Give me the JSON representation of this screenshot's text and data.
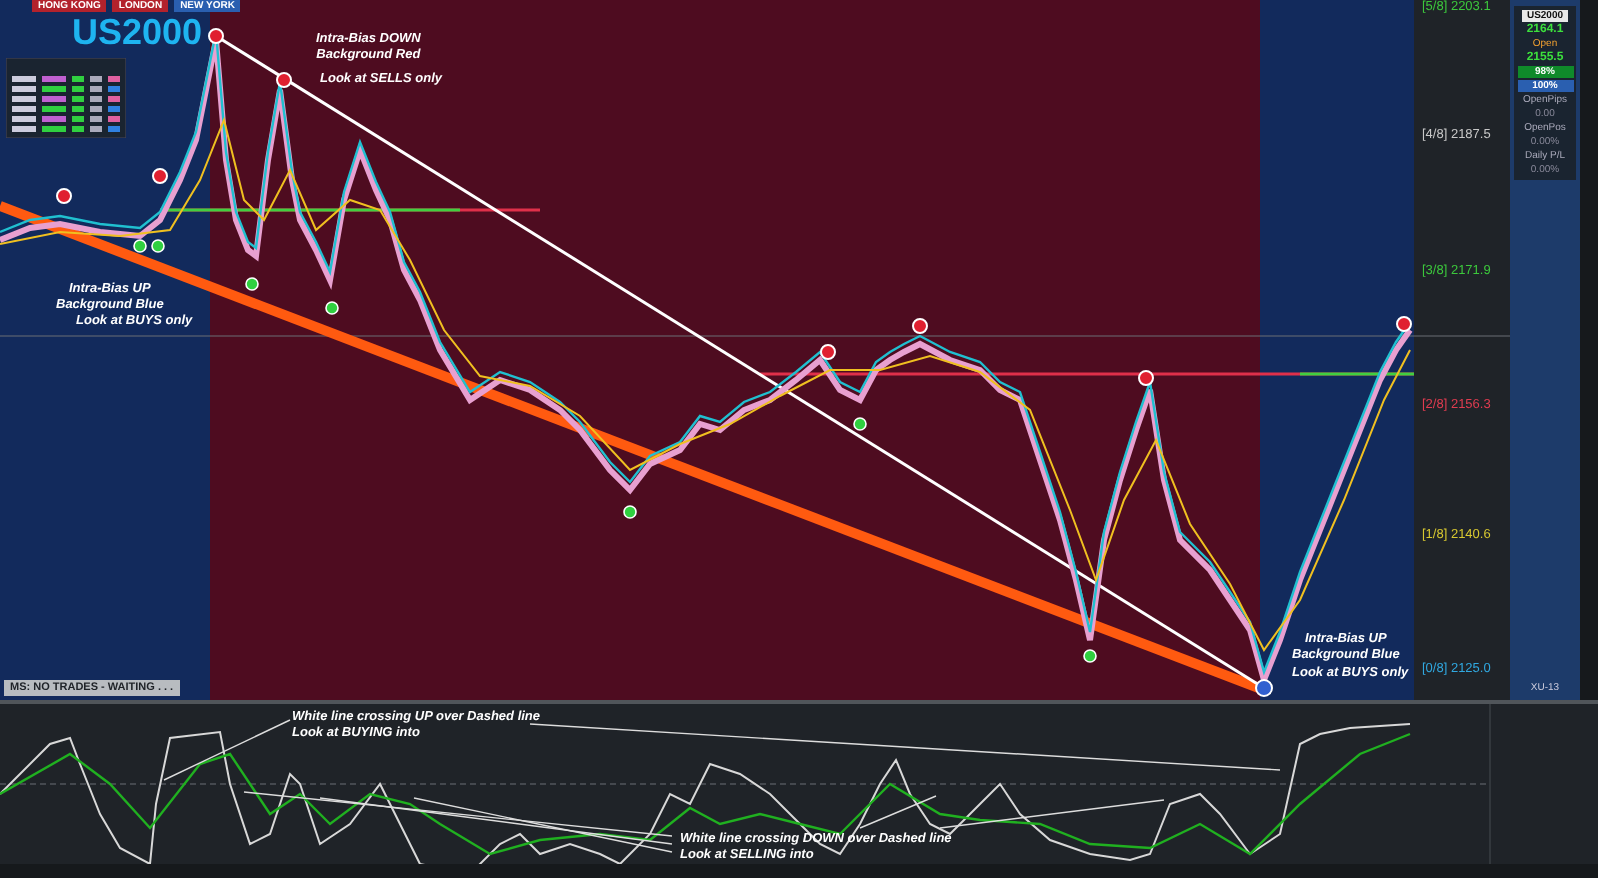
{
  "chart": {
    "symbol": "US2000",
    "sessions": [
      {
        "label": "HONG KONG",
        "color": "#b3222c"
      },
      {
        "label": "LONDON",
        "color": "#b3222c"
      },
      {
        "label": "NEW YORK",
        "color": "#2a5fb0"
      }
    ],
    "zones": [
      {
        "color": "#122a5c"
      },
      {
        "color": "#4e0c20"
      },
      {
        "color": "#122a5c"
      }
    ],
    "annotations": [
      {
        "text": "Intra-Bias DOWN\nBackground Red"
      },
      {
        "text": "Look at SELLS only"
      },
      {
        "text": "Intra-Bias UP\nBackground Blue"
      },
      {
        "text": "Look at BUYS only"
      },
      {
        "text": "Intra-Bias UP\nBackground Blue"
      },
      {
        "text": "Look at BUYS only"
      }
    ],
    "levels": [
      {
        "label": "[5/8] 2203.1",
        "color": "#3cc83c"
      },
      {
        "label": "[4/8] 2187.5",
        "color": "#c8c8c8"
      },
      {
        "label": "[3/8] 2171.9",
        "color": "#3cc83c"
      },
      {
        "label": "[2/8] 2156.3",
        "color": "#e03c50"
      },
      {
        "label": "[1/8] 2140.6",
        "color": "#d8c830"
      },
      {
        "label": "[0/8] 2125.0",
        "color": "#30a8e0"
      }
    ],
    "status": "MS: NO TRADES - WAITING . . ."
  },
  "info_panel": {
    "symbol": "US2000",
    "price": "2164.1",
    "open_label": "Open",
    "open_price": "2155.5",
    "meters": [
      {
        "reading": "98%",
        "kind": "green"
      },
      {
        "reading": "100%",
        "kind": "blue"
      }
    ],
    "stats": [
      {
        "label": "OpenPips",
        "value": "0.00"
      },
      {
        "label": "OpenPos",
        "value": "0.00%"
      },
      {
        "label": "Daily P/L",
        "value": "0.00%"
      }
    ],
    "footer": "XU-13"
  },
  "oscillator": {
    "annotations": [
      {
        "text": "White line crossing UP over Dashed line\nLook at BUYING into"
      },
      {
        "text": "White line crossing DOWN over Dashed line\nLook at SELLING into"
      }
    ]
  }
}
